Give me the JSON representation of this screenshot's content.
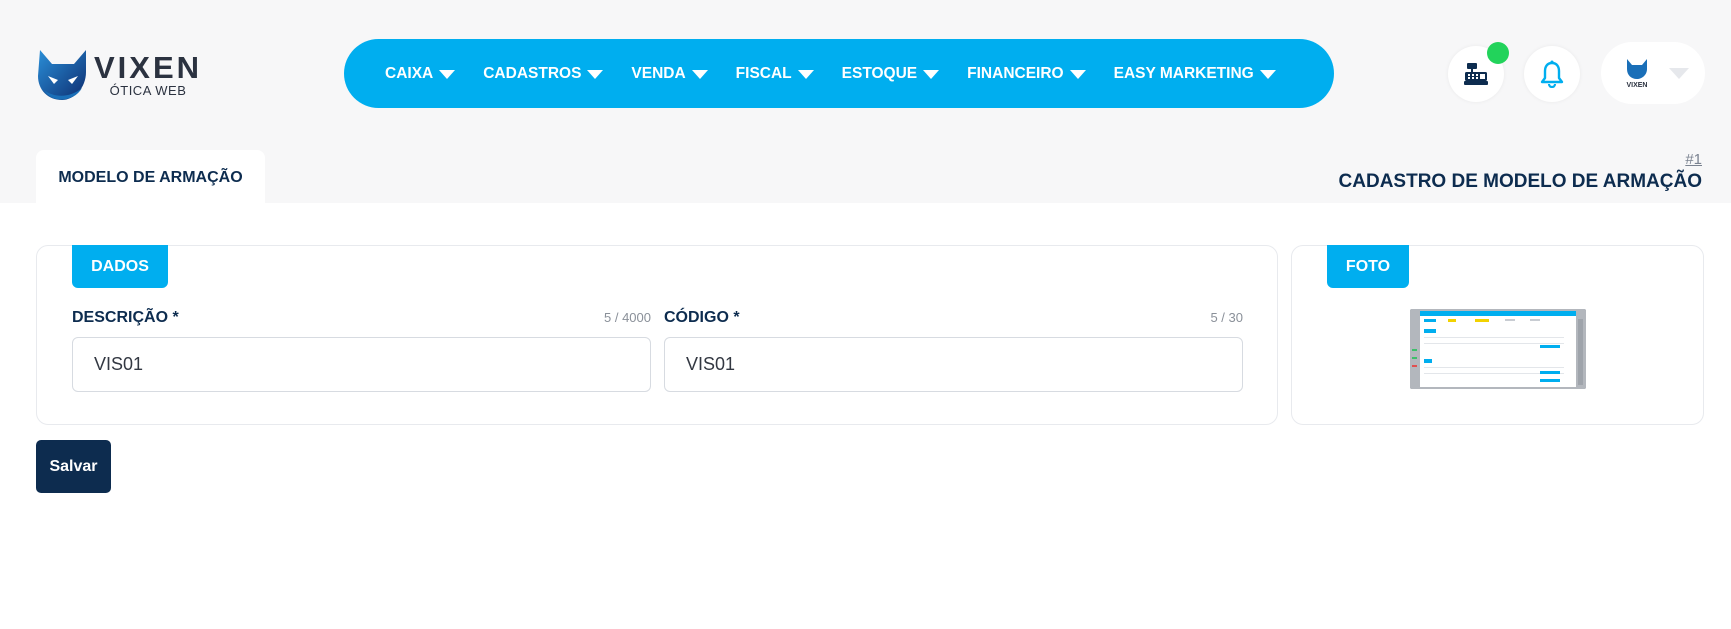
{
  "brand": {
    "name": "VIXEN",
    "subtitle": "ÓTICA WEB",
    "color": "#00aeef",
    "dark": "#0d2c4f"
  },
  "nav": {
    "items": [
      {
        "label": "CAIXA"
      },
      {
        "label": "CADASTROS"
      },
      {
        "label": "VENDA"
      },
      {
        "label": "FISCAL"
      },
      {
        "label": "ESTOQUE"
      },
      {
        "label": "FINANCEIRO"
      },
      {
        "label": "EASY MARKETING"
      }
    ]
  },
  "header_actions": {
    "register_icon": "cash-register-icon",
    "notification_icon": "bell-icon",
    "status_color": "#22d35b",
    "avatar_text": "VIXEN"
  },
  "tab": {
    "label": "MODELO DE ARMAÇÃO"
  },
  "page": {
    "number": "#1",
    "title": "CADASTRO DE MODELO DE ARMAÇÃO"
  },
  "dados": {
    "section_label": "DADOS",
    "descricao": {
      "label": "DESCRIÇÃO *",
      "count": "5 / 4000",
      "value": "VIS01"
    },
    "codigo": {
      "label": "CÓDIGO *",
      "count": "5 / 30",
      "value": "VIS01"
    }
  },
  "foto": {
    "section_label": "FOTO"
  },
  "actions": {
    "save_label": "Salvar"
  }
}
